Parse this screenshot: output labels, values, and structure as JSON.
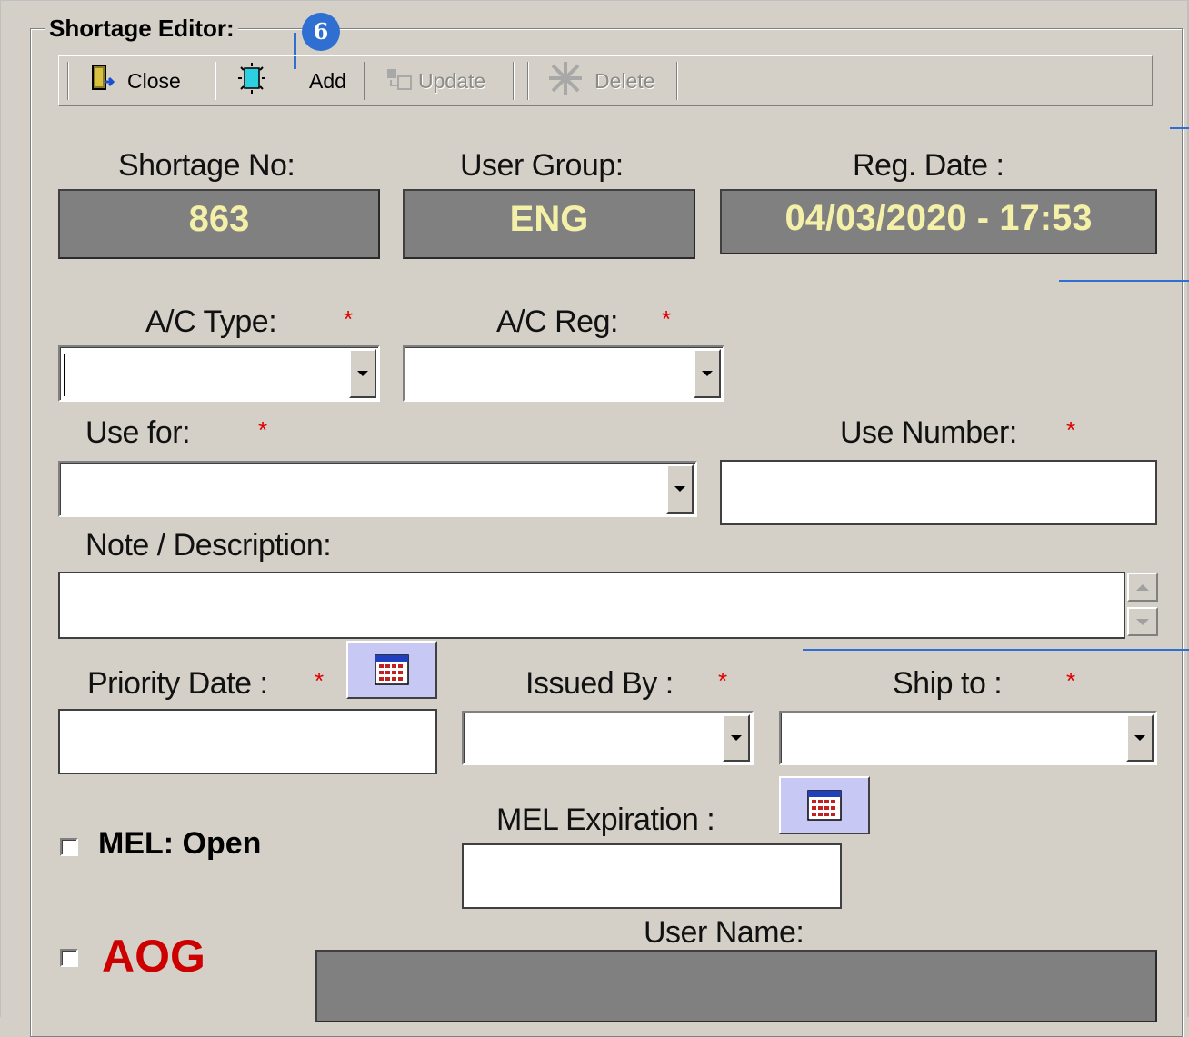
{
  "group_title": "Shortage Editor:",
  "callout_number": "6",
  "toolbar": {
    "close": "Close",
    "add": "Add",
    "update": "Update",
    "delete": "Delete"
  },
  "header": {
    "shortage_no_label": "Shortage  No:",
    "shortage_no_value": "863",
    "user_group_label": "User Group:",
    "user_group_value": "ENG",
    "reg_date_label": "Reg. Date :",
    "reg_date_value": "04/03/2020 - 17:53"
  },
  "form": {
    "required_mark": "*",
    "ac_type_label": "A/C Type:",
    "ac_type_value": "",
    "ac_reg_label": "A/C Reg:",
    "ac_reg_value": "",
    "use_for_label": "Use for:",
    "use_for_value": "",
    "use_number_label": "Use Number:",
    "use_number_value": "",
    "note_label": "Note / Description:",
    "note_value": "",
    "priority_date_label": "Priority Date :",
    "priority_date_value": "",
    "issued_by_label": "Issued By :",
    "issued_by_value": "",
    "ship_to_label": "Ship to :",
    "ship_to_value": "",
    "mel_label": "MEL: Open",
    "mel_checked": false,
    "mel_expiration_label": "MEL Expiration :",
    "mel_expiration_value": "",
    "aog_label": "AOG",
    "aog_checked": false,
    "user_name_label": "User  Name:",
    "user_name_value": ""
  },
  "colors": {
    "panel": "#d4d0c8",
    "display_bg": "#808080",
    "display_text": "#f4f0a8",
    "required": "#e00000",
    "aog": "#cc0000",
    "callout": "#2f6fd2",
    "calendar_btn": "#c8c8f4"
  }
}
